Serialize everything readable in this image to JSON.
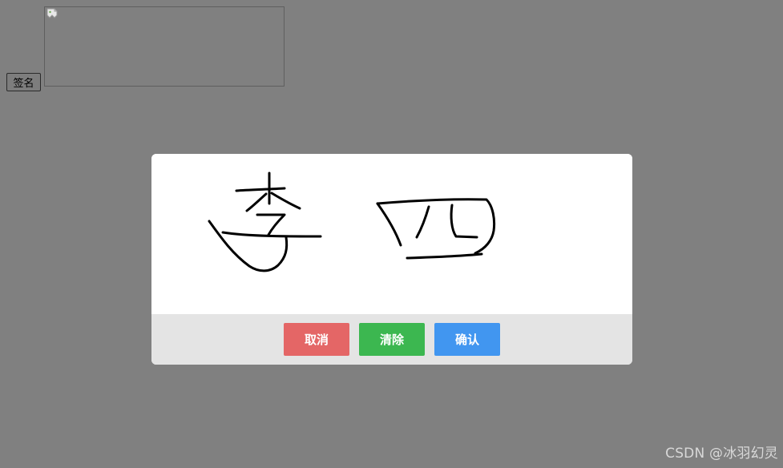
{
  "trigger": {
    "sign_label": "签名"
  },
  "signature_preview": {
    "state": "broken-image",
    "icon": "broken-image-icon"
  },
  "signature_pad": {
    "content": "handwritten-strokes",
    "ink_color": "#000000"
  },
  "actions": {
    "cancel_label": "取消",
    "clear_label": "清除",
    "confirm_label": "确认",
    "cancel_color": "#e46666",
    "clear_color": "#3cb750",
    "confirm_color": "#4196f0"
  },
  "watermark": {
    "text": "CSDN @冰羽幻灵"
  }
}
